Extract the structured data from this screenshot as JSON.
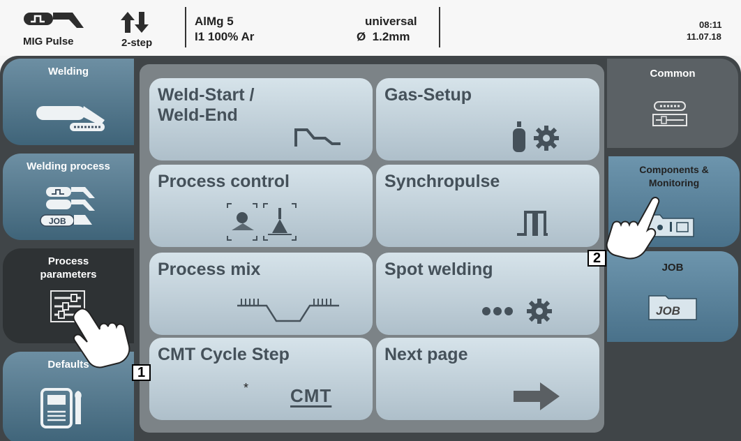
{
  "header": {
    "mode_label": "MIG Pulse",
    "step_label": "2-step",
    "material": "AlMg 5",
    "gas": "I1 100% Ar",
    "wire_type": "universal",
    "wire_diameter": "Ø  1.2mm",
    "time": "08:11",
    "date": "11.07.18"
  },
  "sidebar": {
    "items": [
      {
        "label": "Welding"
      },
      {
        "label": "Welding process",
        "badge": "JOB"
      },
      {
        "label": "Process\nparameters"
      },
      {
        "label": "Defaults"
      }
    ]
  },
  "tiles": [
    {
      "label": "Weld-Start /\nWeld-End"
    },
    {
      "label": "Gas-Setup"
    },
    {
      "label": "Process control"
    },
    {
      "label": "Synchropulse"
    },
    {
      "label": "Process mix"
    },
    {
      "label": "Spot welding"
    },
    {
      "label": "CMT Cycle Step",
      "note": "*",
      "logo": "CMT"
    },
    {
      "label": "Next page"
    }
  ],
  "right_panel": {
    "common": {
      "label": "Common"
    },
    "components": {
      "label": "Components &\nMonitoring"
    },
    "job": {
      "label": "JOB",
      "icon_text": "JOB"
    }
  },
  "markers": {
    "one": "1",
    "two": "2"
  },
  "colors": {
    "tile_top": "#d6e3ea",
    "tile_bottom": "#aebfca",
    "frame": "#404548",
    "accent_blue": "#5b7f94",
    "text_dark": "#45515a"
  }
}
